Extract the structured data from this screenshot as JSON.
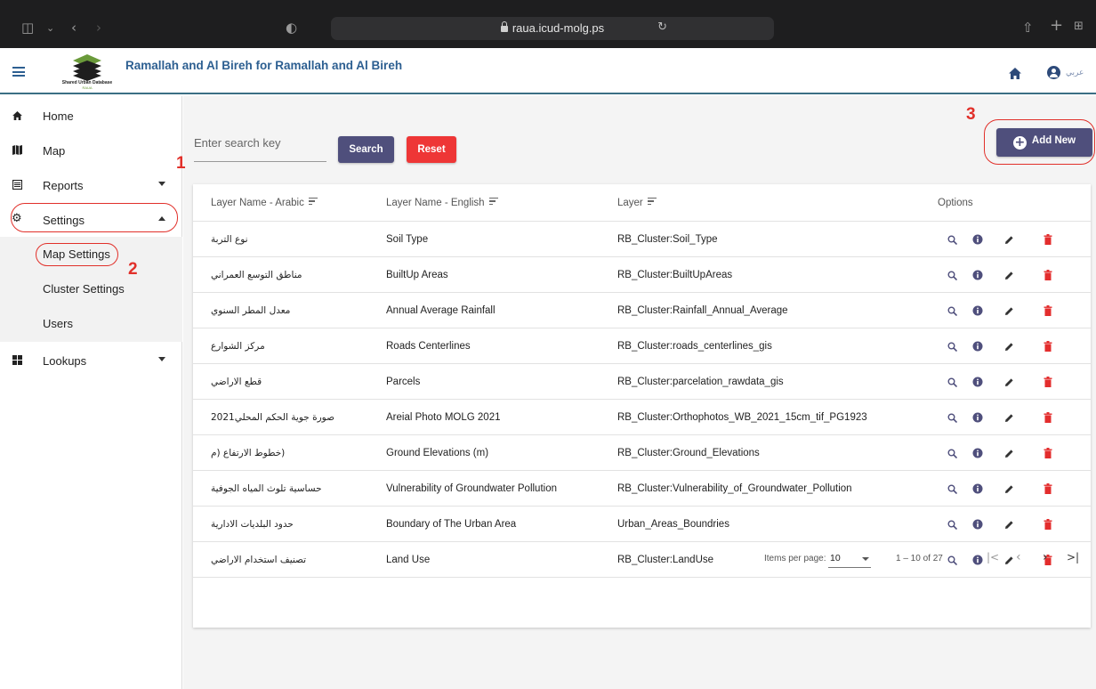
{
  "browser": {
    "url": "raua.icud-molg.ps"
  },
  "app": {
    "title": "Ramallah and Al Bireh for Ramallah and Al Bireh",
    "logo_text": "Shared Urban Database",
    "logo_subtext": "RAUA",
    "lang_toggle": "ﻋﺮﺑﻲ"
  },
  "sidebar": {
    "home": "Home",
    "map": "Map",
    "reports": "Reports",
    "settings": "Settings",
    "map_settings": "Map Settings",
    "cluster_settings": "Cluster Settings",
    "users": "Users",
    "lookups": "Lookups"
  },
  "annotations": {
    "n1": "1",
    "n2": "2",
    "n3": "3"
  },
  "toolbar": {
    "search_placeholder": "Enter search key",
    "search_label": "Search",
    "reset_label": "Reset",
    "add_label": "Add New"
  },
  "table": {
    "headers": {
      "arabic": "Layer Name - Arabic",
      "english": "Layer Name - English",
      "layer": "Layer",
      "options": "Options"
    },
    "rows": [
      {
        "arabic": "نوع التربة",
        "english": "Soil Type",
        "layer": "RB_Cluster:Soil_Type"
      },
      {
        "arabic": "مناطق التوسع العمراني",
        "english": "BuiltUp Areas",
        "layer": "RB_Cluster:BuiltUpAreas"
      },
      {
        "arabic": "معدل المطر السنوي",
        "english": "Annual Average Rainfall",
        "layer": "RB_Cluster:Rainfall_Annual_Average"
      },
      {
        "arabic": "مركز الشوارع",
        "english": "Roads Centerlines",
        "layer": "RB_Cluster:roads_centerlines_gis"
      },
      {
        "arabic": "قطع الاراضي",
        "english": "Parcels",
        "layer": "RB_Cluster:parcelation_rawdata_gis"
      },
      {
        "arabic": "صورة جوية الحكم المحلي2021",
        "english": "Areial Photo MOLG 2021",
        "layer": "RB_Cluster:Orthophotos_WB_2021_15cm_tif_PG1923"
      },
      {
        "arabic": "(خطوط الارتفاع (م",
        "english": "Ground Elevations (m)",
        "layer": "RB_Cluster:Ground_Elevations"
      },
      {
        "arabic": "حساسية تلوث المياه الجوفية",
        "english": "Vulnerability of Groundwater Pollution",
        "layer": "RB_Cluster:Vulnerability_of_Groundwater_Pollution"
      },
      {
        "arabic": "حدود البلديات الادارية",
        "english": "Boundary of The Urban Area",
        "layer": "Urban_Areas_Boundries"
      },
      {
        "arabic": "تصنيف استخدام الاراضي",
        "english": "Land Use",
        "layer": "RB_Cluster:LandUse"
      }
    ]
  },
  "paginator": {
    "items_per_page_label": "Items per page:",
    "page_size": "10",
    "range": "1 – 10 of 27"
  },
  "colors": {
    "primary": "#4f4f7c",
    "danger": "#ee3636",
    "brand": "#2d5f91",
    "annotation": "#e1302a"
  }
}
